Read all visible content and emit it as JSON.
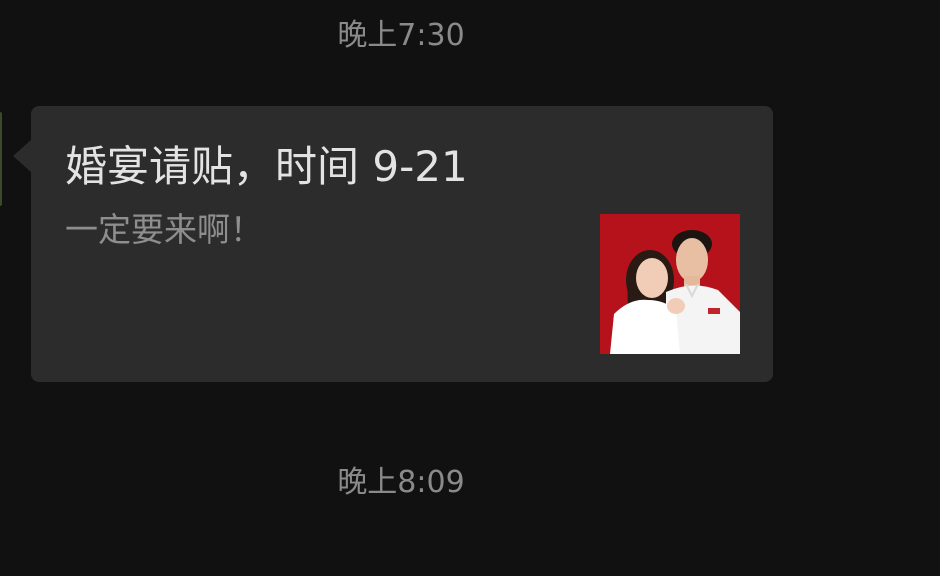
{
  "timestamps": {
    "top": "晚上7:30",
    "bottom": "晚上8:09"
  },
  "message_card": {
    "title": "婚宴请贴，时间 9-21",
    "description": "一定要来啊！",
    "thumbnail_icon": "wedding-photo-thumbnail"
  },
  "colors": {
    "background": "#111111",
    "bubble": "#2c2c2c",
    "title_text": "#e3e3e3",
    "secondary_text": "#8e8e8e",
    "thumbnail_bg": "#b5121b"
  }
}
